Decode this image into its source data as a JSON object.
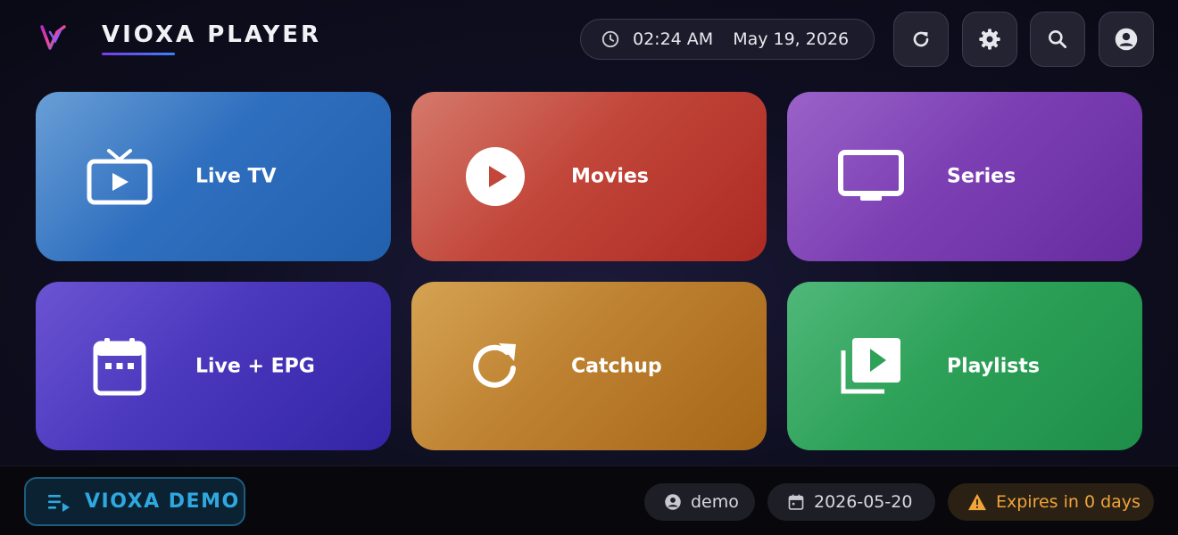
{
  "header": {
    "brand": "VIOXA PLAYER",
    "time": "02:24 AM",
    "date": "May 19, 2026",
    "buttons": [
      "refresh-icon",
      "gear-icon",
      "search-icon",
      "account-icon"
    ]
  },
  "tiles": [
    {
      "label": "Live TV",
      "icon": "tv-icon",
      "color": "#2f6fbf"
    },
    {
      "label": "Movies",
      "icon": "play-circle-icon",
      "color": "#c2463a"
    },
    {
      "label": "Series",
      "icon": "monitor-icon",
      "color": "#7d40b4"
    },
    {
      "label": "Live + EPG",
      "icon": "calendar-icon",
      "color": "#4a38bd"
    },
    {
      "label": "Catchup",
      "icon": "refresh-icon",
      "color": "#bd8131"
    },
    {
      "label": "Playlists",
      "icon": "playlist-icon",
      "color": "#2da158"
    }
  ],
  "footer": {
    "playlist_label": "VIOXA DEMO",
    "user": "demo",
    "expiry_date": "2026-05-20",
    "expiry_notice": "Expires in 0 days"
  },
  "colors": {
    "accent": "#2fa8e0",
    "warning": "#f0a43a"
  }
}
